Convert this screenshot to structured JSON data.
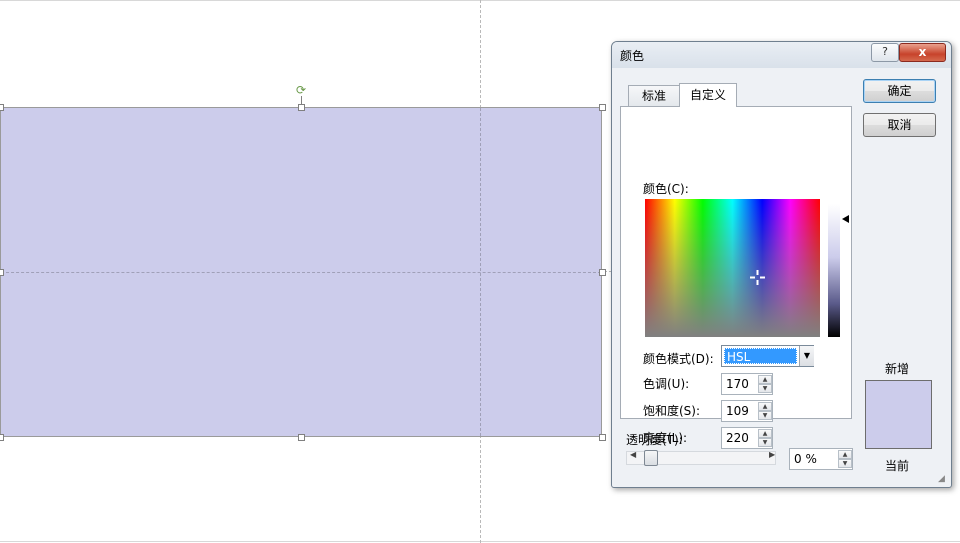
{
  "dialog": {
    "title": "颜色",
    "help_symbol": "?",
    "close_symbol": "x",
    "tabs": [
      {
        "label": "标准",
        "active": false
      },
      {
        "label": "自定义",
        "active": true
      }
    ],
    "colors_label": "颜色(C):",
    "color_mode": {
      "label": "颜色模式(D):",
      "value": "HSL"
    },
    "hue": {
      "label": "色调(U):",
      "value": "170"
    },
    "saturation": {
      "label": "饱和度(S):",
      "value": "109"
    },
    "luminance": {
      "label": "亮度(L):",
      "value": "220"
    },
    "transparency": {
      "label": "透明度(T):",
      "value": "0 %",
      "level": 0
    },
    "ok_label": "确定",
    "cancel_label": "取消",
    "new_label": "新增",
    "current_label": "当前",
    "new_color": "#cccceb",
    "current_color": "#cccceb"
  },
  "slide": {
    "shape_fill": "#cccceb"
  }
}
